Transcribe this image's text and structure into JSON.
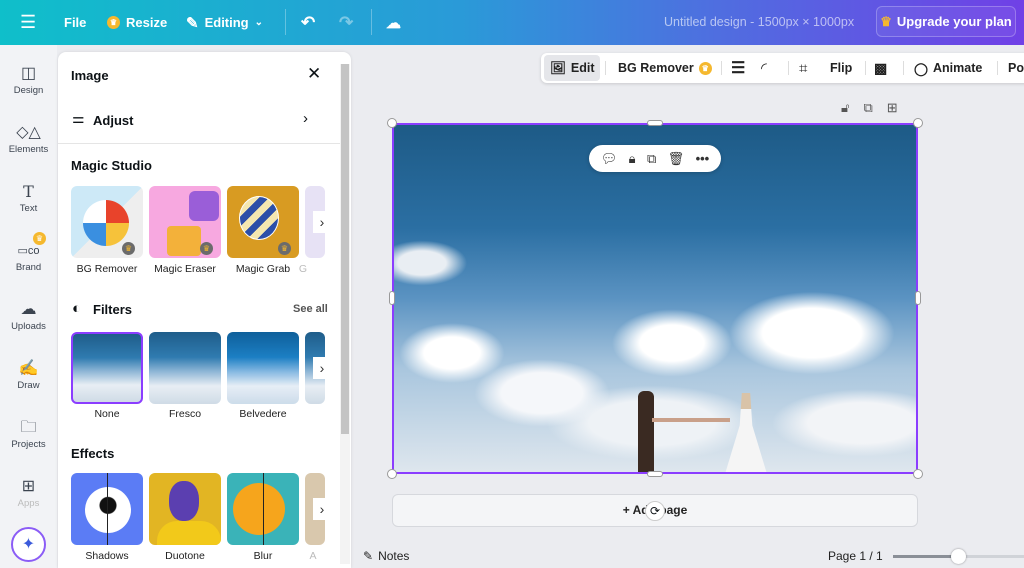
{
  "topbar": {
    "menu_icon": "hamburger-icon",
    "file": "File",
    "resize": "Resize",
    "editing": "Editing",
    "title": "Untitled design - 1500px × 1000px",
    "upgrade": "Upgrade your plan"
  },
  "rail": {
    "items": [
      {
        "label": "Design",
        "icon": "layout-icon"
      },
      {
        "label": "Elements",
        "icon": "shapes-icon"
      },
      {
        "label": "Text",
        "icon": "text-icon"
      },
      {
        "label": "Brand",
        "icon": "brand-icon"
      },
      {
        "label": "Uploads",
        "icon": "cloud-upload-icon"
      },
      {
        "label": "Draw",
        "icon": "pen-icon"
      },
      {
        "label": "Projects",
        "icon": "folder-icon"
      },
      {
        "label": "Apps",
        "icon": "apps-icon"
      }
    ]
  },
  "panel": {
    "title": "Image",
    "adjust": "Adjust",
    "magic_studio": "Magic Studio",
    "magic_items": [
      "BG Remover",
      "Magic Eraser",
      "Magic Grab",
      "G"
    ],
    "filters": "Filters",
    "see_all": "See all",
    "filter_items": [
      "None",
      "Fresco",
      "Belvedere"
    ],
    "effects": "Effects",
    "effect_items": [
      "Shadows",
      "Duotone",
      "Blur",
      "A"
    ]
  },
  "context_toolbar": {
    "edit": "Edit",
    "bg_remover": "BG Remover",
    "flip": "Flip",
    "animate": "Animate",
    "position": "Pos"
  },
  "canvas": {
    "add_page": "+ Add page"
  },
  "footer": {
    "notes": "Notes",
    "page": "Page 1 / 1",
    "zoom_fraction": 0.5
  },
  "colors": {
    "accent": "#8b3dff",
    "crown": "#f5b82e"
  }
}
